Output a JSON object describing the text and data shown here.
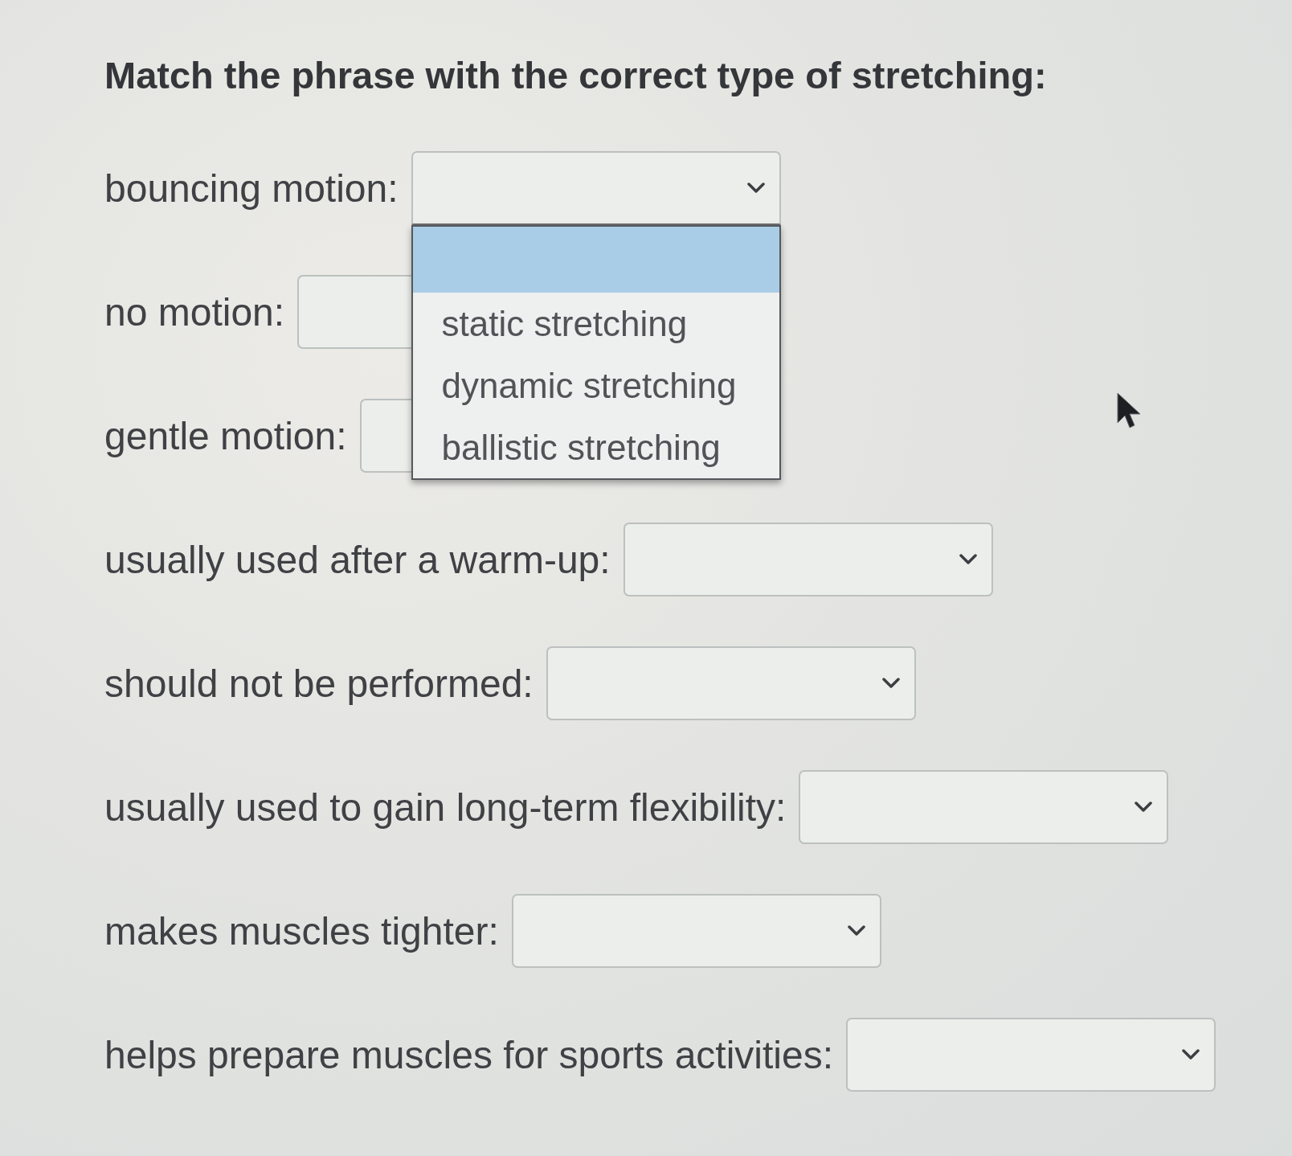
{
  "title": "Match the phrase with the correct type of stretching:",
  "items": [
    {
      "label": "bouncing motion:",
      "expanded": true,
      "blank_option": {
        "selected": true
      },
      "options": [
        {
          "label": "static stretching",
          "selected": false
        },
        {
          "label": "dynamic stretching",
          "selected": false
        },
        {
          "label": "ballistic stretching",
          "selected": false
        }
      ]
    },
    {
      "label": "no motion:",
      "expanded": false
    },
    {
      "label": "gentle motion:",
      "expanded": false
    },
    {
      "label": "usually used after a warm-up:",
      "expanded": false
    },
    {
      "label": "should not be performed:",
      "expanded": false
    },
    {
      "label": "usually used to gain long-term flexibility:",
      "expanded": false
    },
    {
      "label": "makes muscles tighter:",
      "expanded": false
    },
    {
      "label": "helps prepare muscles for sports activities:",
      "expanded": false
    }
  ]
}
